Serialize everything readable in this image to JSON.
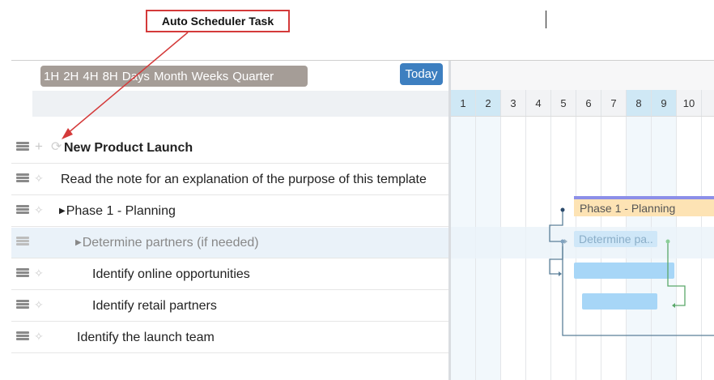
{
  "callout": {
    "label": "Auto Scheduler Task"
  },
  "toolbar": {
    "zoom_levels": [
      "1H",
      "2H",
      "4H",
      "8H",
      "Days",
      "Month",
      "Weeks",
      "Quarter"
    ],
    "today_label": "Today"
  },
  "timeline": {
    "days": [
      "1",
      "2",
      "3",
      "4",
      "5",
      "6",
      "7",
      "8",
      "9",
      "10"
    ],
    "highlighted_days": [
      "1",
      "2",
      "8",
      "9"
    ]
  },
  "tasks": [
    {
      "name": "New Product Launch",
      "bold": true,
      "expandable": false
    },
    {
      "name": "Read the note for an explanation of the purpose of this template"
    },
    {
      "name": "Phase 1 - Planning",
      "expandable": true
    },
    {
      "name": "Determine partners (if needed)",
      "expandable": true,
      "selected": true
    },
    {
      "name": "Identify online opportunities"
    },
    {
      "name": "Identify retail partners"
    },
    {
      "name": "Identify the launch team"
    }
  ],
  "gantt": {
    "phase_bar_label": "Phase 1 - Planning",
    "determine_bar_label": "Determine pa.."
  },
  "colors": {
    "callout_border": "#d43a3a",
    "today_button": "#3d7fc0",
    "zoom_bar": "#a59d97",
    "phase_bar": "#fde3b4",
    "phase_bar_top": "#8c8fe8",
    "task_bar": "#a7d6f7",
    "link_blue": "#5b7f99",
    "link_green": "#5aa86a"
  }
}
